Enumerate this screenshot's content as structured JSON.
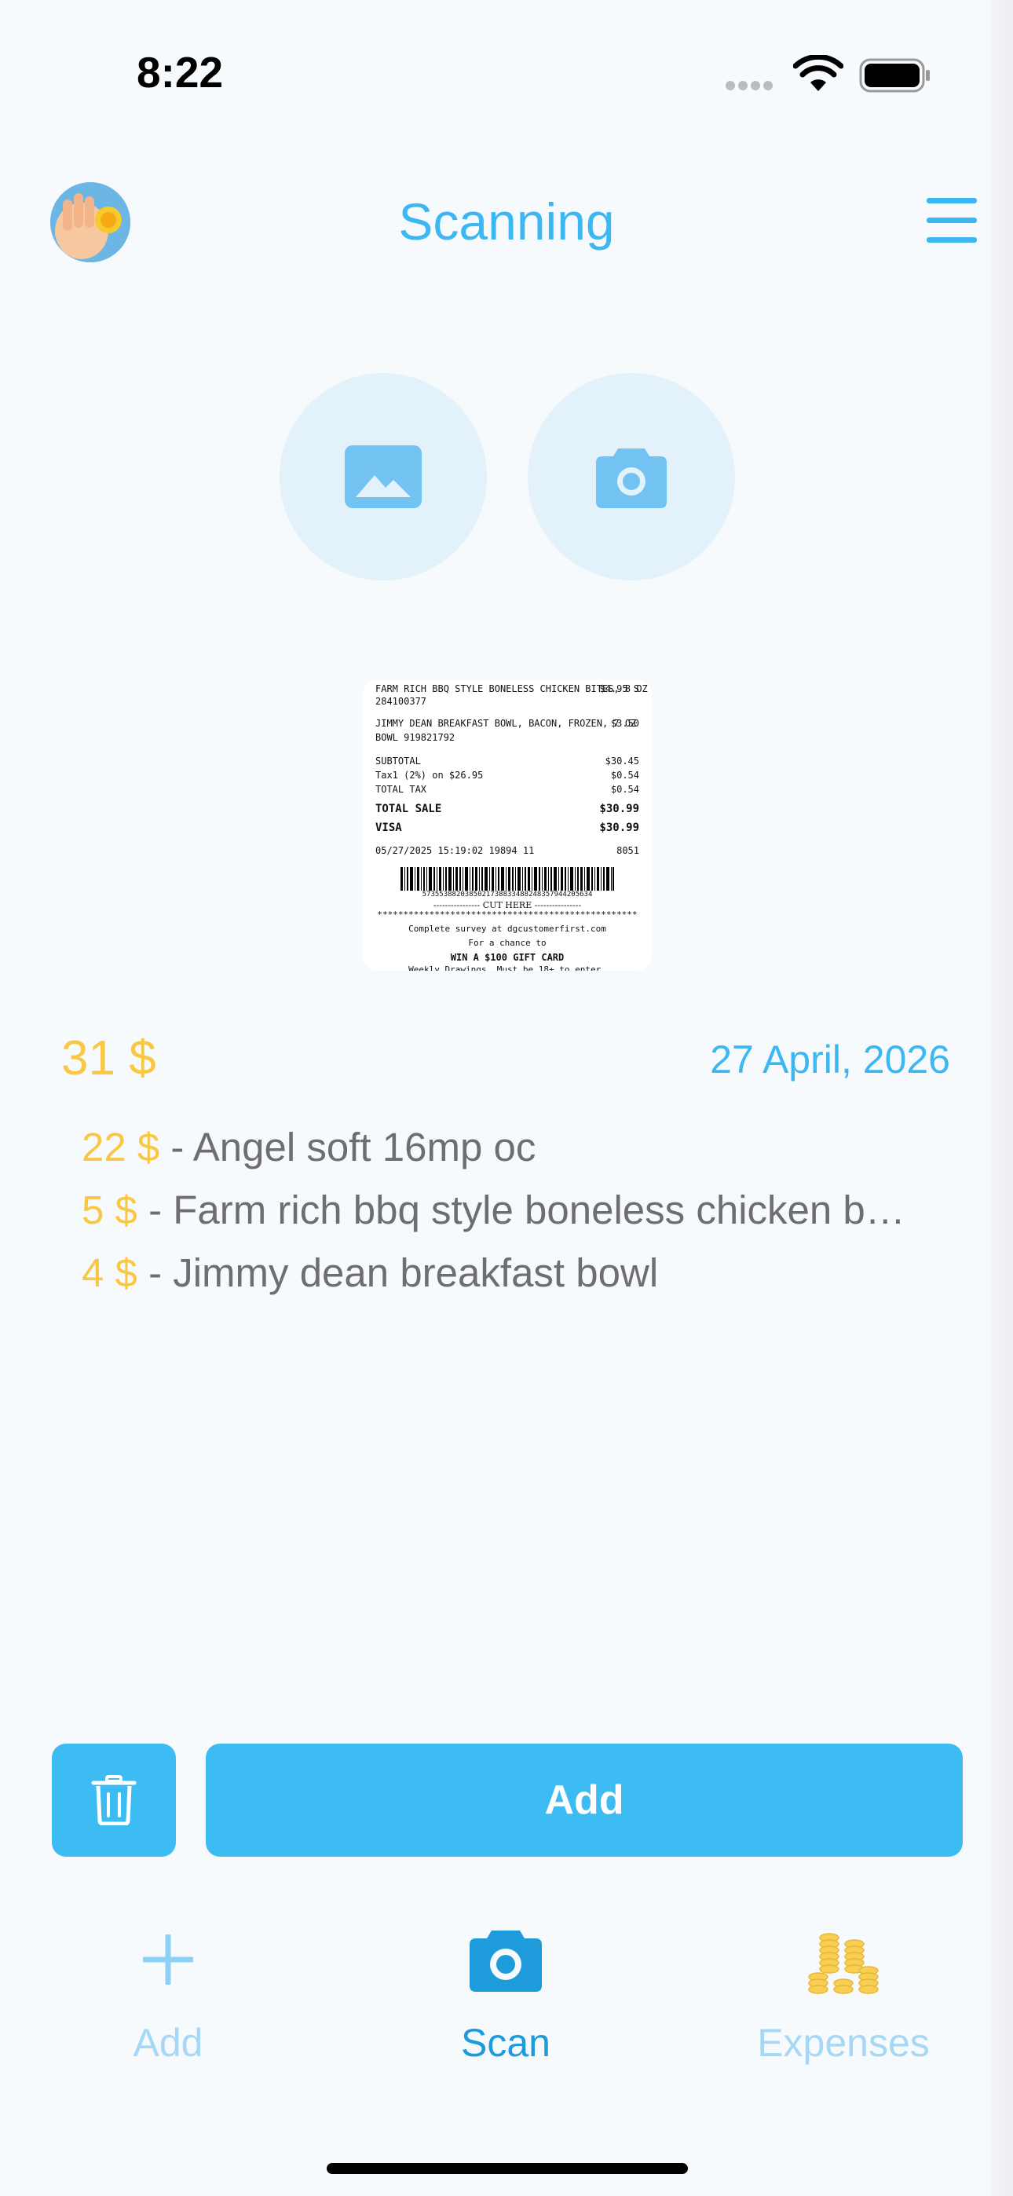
{
  "status_bar": {
    "time": "8:22"
  },
  "header": {
    "title": "Scanning"
  },
  "receipt": {
    "lines": [
      {
        "text": "FARM RICH BBQ STYLE BONELESS CHICKEN BITES, 8 OZ",
        "amount": "$4.95 S"
      },
      {
        "text": "284100377",
        "amount": ""
      },
      {
        "text": "JIMMY DEAN BREAKFAST BOWL, BACON, FROZEN, 7 OZ",
        "amount": "$3.50"
      },
      {
        "text": "BOWL 919821792",
        "amount": ""
      },
      {
        "text": "SUBTOTAL",
        "amount": "$30.45"
      },
      {
        "text": "Tax1 (2%) on $26.95",
        "amount": "$0.54"
      },
      {
        "text": "TOTAL TAX",
        "amount": "$0.54"
      },
      {
        "text": "TOTAL SALE",
        "amount": "$30.99"
      },
      {
        "text": "VISA",
        "amount": "$30.99"
      },
      {
        "text": "05/27/2025 15:19:02 19894 11",
        "amount": "8051"
      }
    ],
    "barcode_number": "5735538820385021738833488248357944205634",
    "cut_here": "---------------- CUT HERE ----------------",
    "stars": "**************************************************",
    "survey_line": "Complete survey at dgcustomerfirst.com",
    "chance_line": "For a chance to",
    "win_line": "WIN A $100 GIFT CARD",
    "weekly_line": "Weekly Drawings. Must be 18+ to enter."
  },
  "summary": {
    "total": "31 $",
    "date": "27 April, 2026"
  },
  "items": [
    {
      "price": "22 $",
      "name": " - Angel soft 16mp oc"
    },
    {
      "price": "5 $",
      "name": " - Farm rich bbq style boneless chicken b…"
    },
    {
      "price": "4 $",
      "name": " - Jimmy dean breakfast bowl"
    }
  ],
  "actions": {
    "add_label": "Add"
  },
  "tabs": [
    {
      "label": "Add",
      "icon": "plus-icon"
    },
    {
      "label": "Scan",
      "icon": "camera-icon"
    },
    {
      "label": "Expenses",
      "icon": "coins-icon"
    }
  ],
  "colors": {
    "accent": "#3DB7F2",
    "price": "#F9C744",
    "background": "#F7FAFD"
  }
}
